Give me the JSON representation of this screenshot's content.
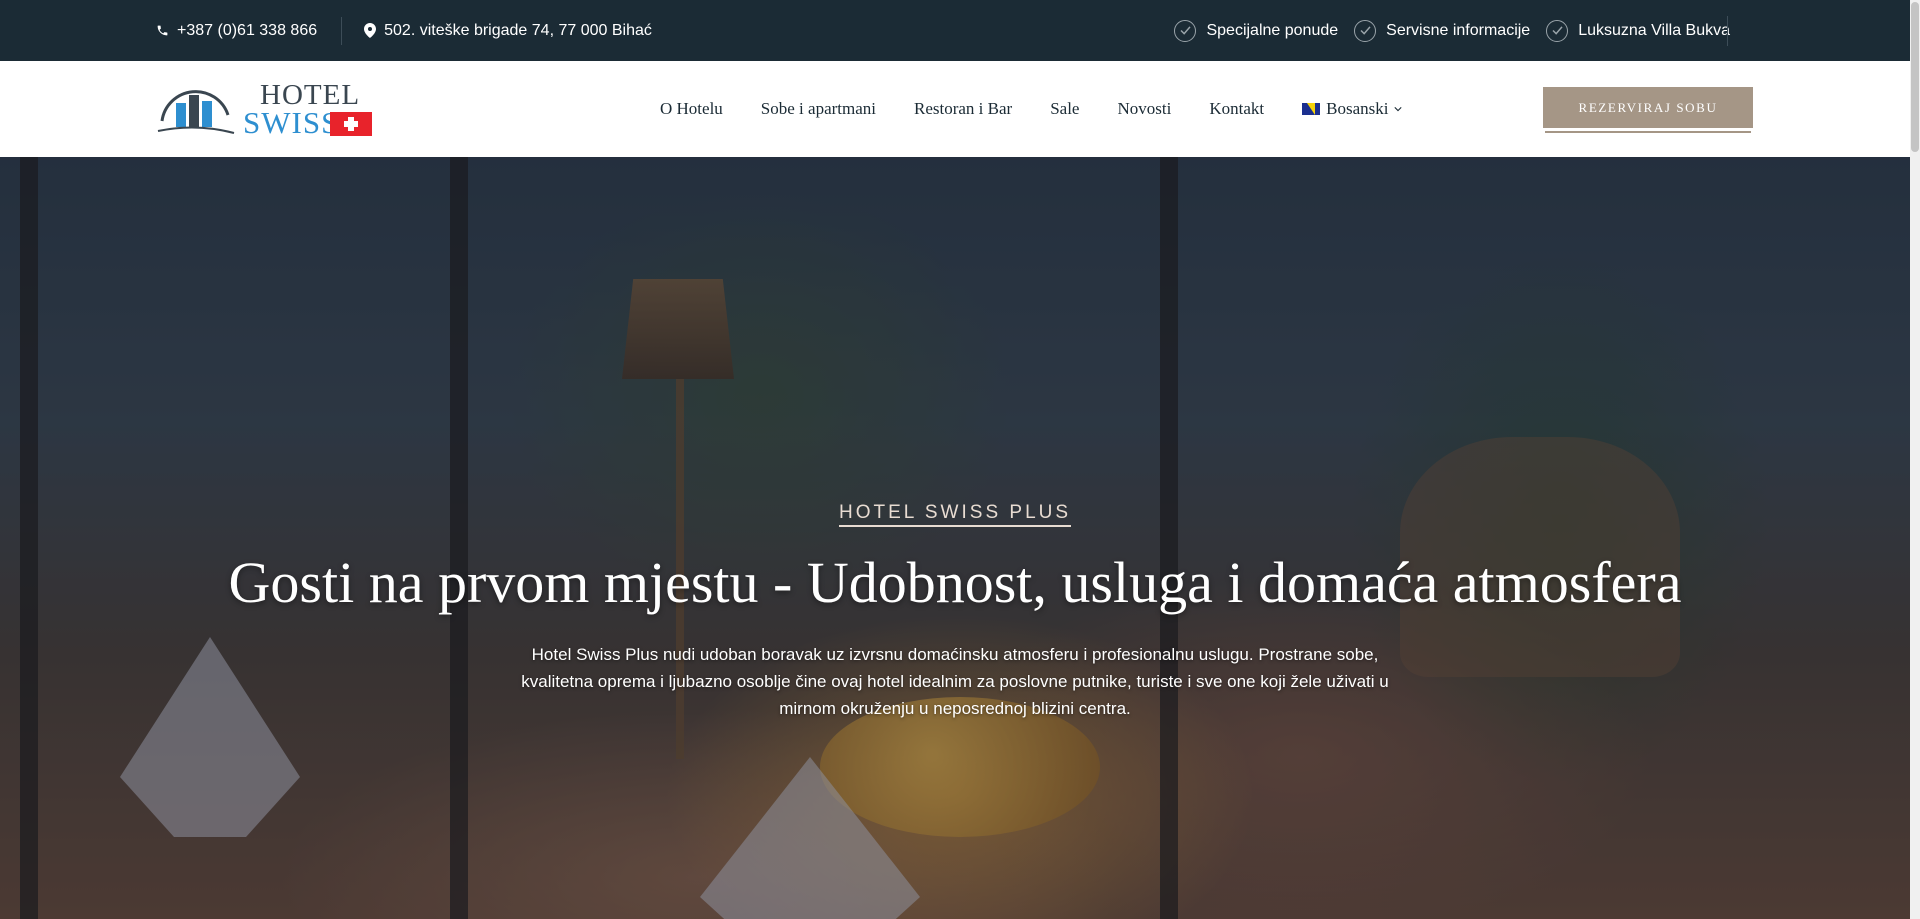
{
  "topbar": {
    "phone": "+387 (0)61 338 866",
    "address": "502. viteške brigade 74, 77 000 Bihać",
    "links": [
      "Specijalne ponude",
      "Servisne informacije",
      "Luksuzna Villa Bukva"
    ]
  },
  "header": {
    "logo_hotel": "HOTEL",
    "logo_swiss": "SWISS",
    "nav": [
      "O Hotelu",
      "Sobe i apartmani",
      "Restoran i Bar",
      "Sale",
      "Novosti",
      "Kontakt"
    ],
    "language": "Bosanski",
    "book_button": "REZERVIRAJ SOBU"
  },
  "hero": {
    "eyebrow": "HOTEL SWISS PLUS",
    "headline": "Gosti na prvom mjestu - Udobnost, usluga i domaća atmosfera",
    "description": "Hotel Swiss Plus nudi udoban boravak uz izvrsnu domaćinsku atmosferu i profesionalnu uslugu. Prostrane sobe, kvalitetna oprema i ljubazno osoblje čine ovaj hotel idealnim za poslovne putnike, turiste i sve one koji žele uživati u mirnom okruženju u neposrednoj blizini centra."
  },
  "colors": {
    "topbar_bg": "#1b2b35",
    "accent": "#a59686",
    "logo_blue": "#2e8fd0",
    "flag_red": "#e8232b"
  }
}
